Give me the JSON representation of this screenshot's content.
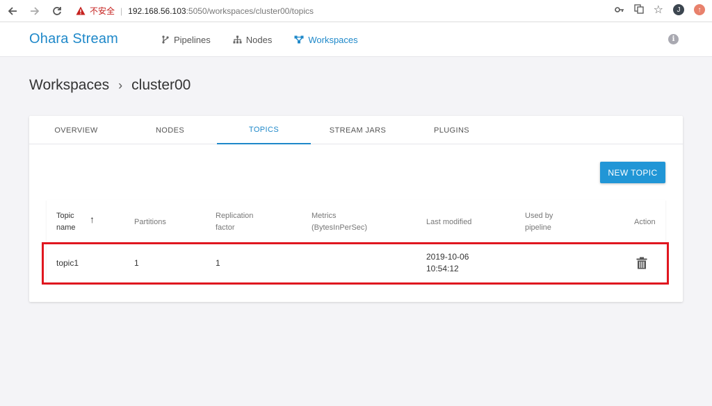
{
  "browser": {
    "insecure_label": "不安全",
    "url_host": "192.168.56.103",
    "url_path": ":5050/workspaces/cluster00/topics",
    "avatar_letter": "J"
  },
  "app": {
    "brand": "Ohara Stream",
    "nav": [
      {
        "label": "Pipelines",
        "icon": "pipelines-icon"
      },
      {
        "label": "Nodes",
        "icon": "nodes-icon"
      },
      {
        "label": "Workspaces",
        "icon": "workspaces-icon",
        "active": true
      }
    ]
  },
  "breadcrumb": {
    "root": "Workspaces",
    "separator": "›",
    "current": "cluster00"
  },
  "tabs": [
    "OVERVIEW",
    "NODES",
    "TOPICS",
    "STREAM JARS",
    "PLUGINS"
  ],
  "active_tab": "TOPICS",
  "new_topic_label": "NEW TOPIC",
  "table": {
    "headers": {
      "name_1": "Topic",
      "name_2": "name",
      "partitions": "Partitions",
      "replication_1": "Replication",
      "replication_2": "factor",
      "metrics_1": "Metrics",
      "metrics_2": "(BytesInPerSec)",
      "last_modified": "Last modified",
      "used_by_1": "Used by",
      "used_by_2": "pipeline",
      "action": "Action"
    },
    "rows": [
      {
        "name": "topic1",
        "partitions": "1",
        "replication": "1",
        "metrics": "",
        "date": "2019-10-06",
        "time": "10:54:12",
        "used_by": ""
      }
    ]
  },
  "colors": {
    "accent": "#1e88c9",
    "button": "#2196d6",
    "highlight": "#e0161f"
  }
}
